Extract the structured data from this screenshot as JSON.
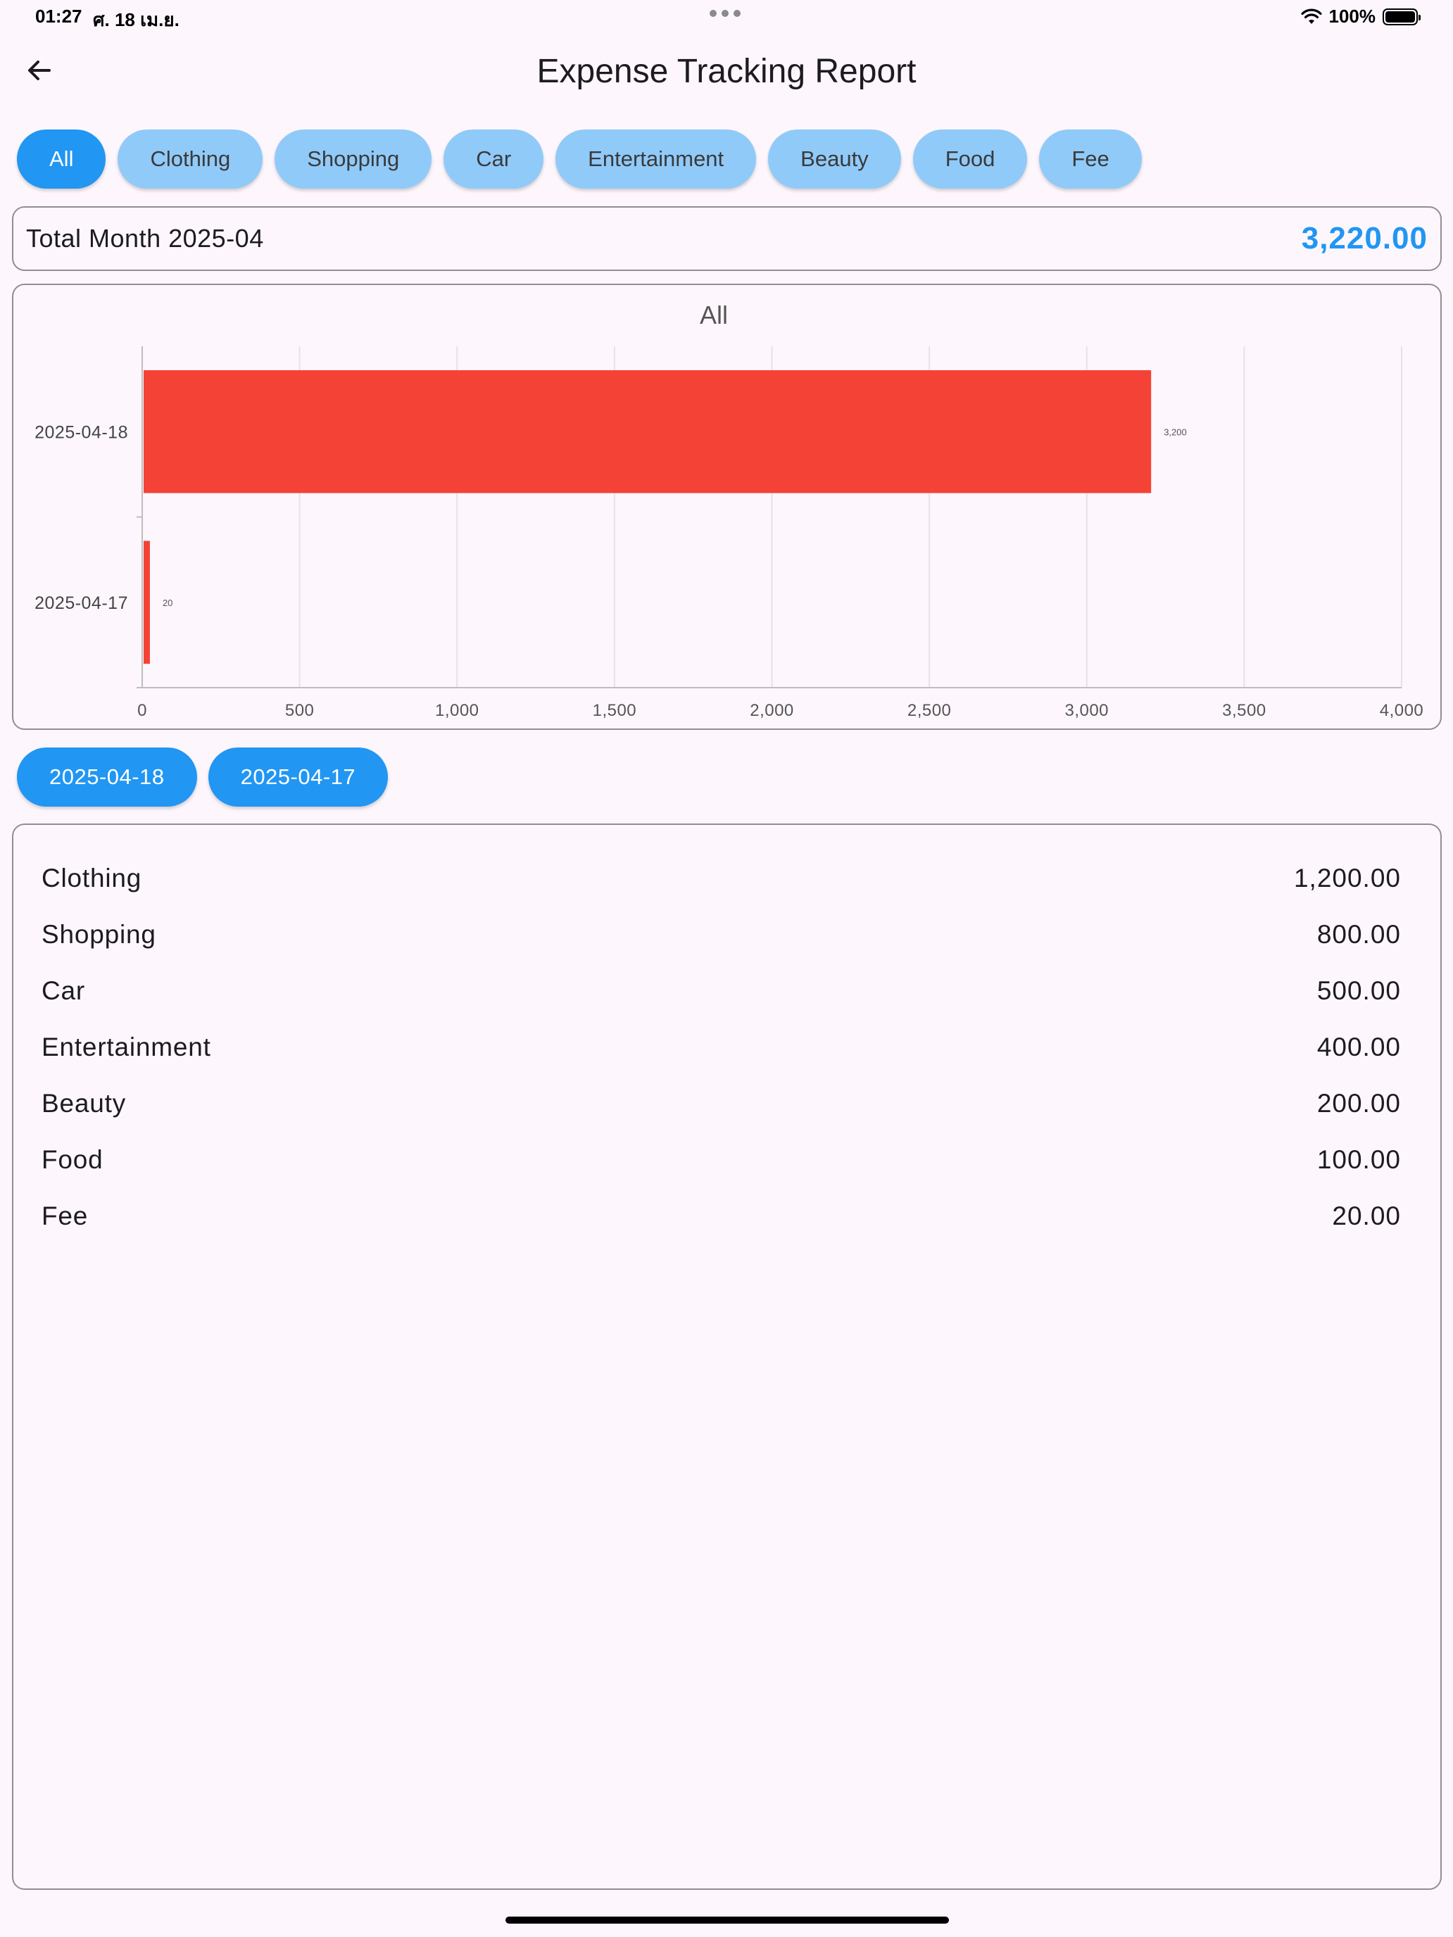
{
  "status_bar": {
    "time": "01:27",
    "date": "ศ. 18 เม.ย.",
    "battery": "100%"
  },
  "app_bar": {
    "back_icon": "arrow-left-icon",
    "title": "Expense Tracking Report"
  },
  "categories": [
    {
      "label": "All",
      "selected": true
    },
    {
      "label": "Clothing",
      "selected": false
    },
    {
      "label": "Shopping",
      "selected": false
    },
    {
      "label": "Car",
      "selected": false
    },
    {
      "label": "Entertainment",
      "selected": false
    },
    {
      "label": "Beauty",
      "selected": false
    },
    {
      "label": "Food",
      "selected": false
    },
    {
      "label": "Fee",
      "selected": false
    }
  ],
  "total": {
    "label": "Total Month 2025-04",
    "value": "3,220.00"
  },
  "chart_data": {
    "type": "bar",
    "orientation": "horizontal",
    "title": "All",
    "categories": [
      "2025-04-18",
      "2025-04-17"
    ],
    "values": [
      3200,
      20
    ],
    "value_labels": [
      "3,200",
      "20"
    ],
    "xlim": [
      0,
      4000
    ],
    "x_ticks": [
      0,
      500,
      1000,
      1500,
      2000,
      2500,
      3000,
      3500,
      4000
    ],
    "x_tick_labels": [
      "0",
      "500",
      "1,000",
      "1,500",
      "2,000",
      "2,500",
      "3,000",
      "3,500",
      "4,000"
    ],
    "grid": "vertical",
    "bar_color": "#F44336"
  },
  "dates": [
    "2025-04-18",
    "2025-04-17"
  ],
  "breakdown": [
    {
      "name": "Clothing",
      "amount": "1,200.00"
    },
    {
      "name": "Shopping",
      "amount": "800.00"
    },
    {
      "name": "Car",
      "amount": "500.00"
    },
    {
      "name": "Entertainment",
      "amount": "400.00"
    },
    {
      "name": "Beauty",
      "amount": "200.00"
    },
    {
      "name": "Food",
      "amount": "100.00"
    },
    {
      "name": "Fee",
      "amount": "20.00"
    }
  ],
  "colors": {
    "accent": "#2196F3",
    "chip_unselected": "#90CAF9",
    "bar": "#F44336"
  }
}
